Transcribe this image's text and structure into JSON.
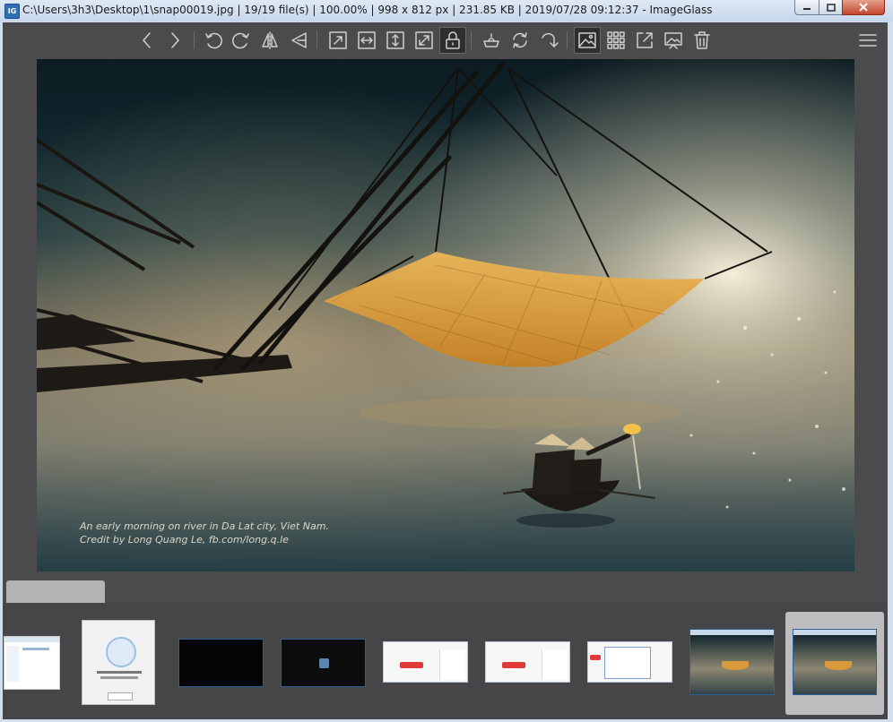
{
  "window": {
    "title": "C:\\Users\\3h3\\Desktop\\1\\snap00019.jpg  |  19/19 file(s)  |  100.00%  |  998 x 812 px  |  231.85 KB  |  2019/07/28 09:12:37  - ImageGlass",
    "app_icon_text": "IG"
  },
  "toolbar": {
    "buttons": [
      {
        "name": "previous-image",
        "icon": "chevron-left-icon"
      },
      {
        "name": "next-image",
        "icon": "chevron-right-icon"
      },
      {
        "name": "rotate-left",
        "icon": "rotate-ccw-icon"
      },
      {
        "name": "rotate-right",
        "icon": "rotate-cw-icon"
      },
      {
        "name": "flip-horizontal",
        "icon": "flip-horizontal-icon"
      },
      {
        "name": "flip-vertical",
        "icon": "flip-vertical-icon"
      },
      {
        "name": "auto-zoom",
        "icon": "auto-zoom-icon"
      },
      {
        "name": "scale-to-width",
        "icon": "scale-width-icon"
      },
      {
        "name": "scale-to-height",
        "icon": "scale-height-icon"
      },
      {
        "name": "scale-to-fit",
        "icon": "scale-fit-icon"
      },
      {
        "name": "lock-zoom",
        "icon": "lock-icon",
        "active": true
      },
      {
        "name": "open-with",
        "icon": "scan-icon"
      },
      {
        "name": "refresh",
        "icon": "refresh-icon"
      },
      {
        "name": "go-to",
        "icon": "goto-icon"
      },
      {
        "name": "thumbnail-bar",
        "icon": "image-icon",
        "active": true
      },
      {
        "name": "checkerboard",
        "icon": "grid-icon"
      },
      {
        "name": "full-screen",
        "icon": "fullscreen-icon"
      },
      {
        "name": "slideshow",
        "icon": "slideshow-icon"
      },
      {
        "name": "delete",
        "icon": "trash-icon"
      },
      {
        "name": "main-menu",
        "icon": "hamburger-menu-icon"
      }
    ]
  },
  "image": {
    "caption_line1": "An early morning on river in Da Lat city, Viet Nam.",
    "caption_line2": "Credit by Long Quang Le, fb.com/long.q.le"
  },
  "thumbnails": [
    {
      "kind": "explorer"
    },
    {
      "kind": "dialog"
    },
    {
      "kind": "black"
    },
    {
      "kind": "black-avatar"
    },
    {
      "kind": "red-button"
    },
    {
      "kind": "red-button"
    },
    {
      "kind": "dialog-popup"
    },
    {
      "kind": "photo"
    },
    {
      "kind": "photo",
      "selected": true
    }
  ],
  "colors": {
    "background": "#4b4b4d",
    "toolbar_icon": "#cfcfcf",
    "active_button": "#2e2e30",
    "selected_thumb": "#bdbdbf"
  }
}
